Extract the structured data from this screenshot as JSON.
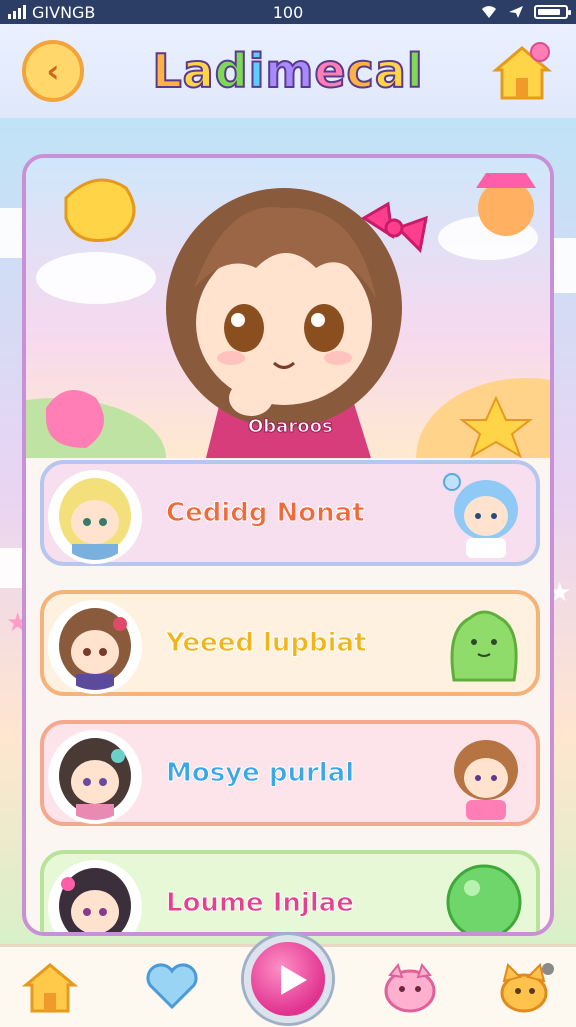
{
  "status_bar": {
    "carrier": "GIVNGB",
    "time": "100",
    "battery_level": 0.85
  },
  "header": {
    "title": "Ladimecal",
    "back_icon": "chevron-left-icon",
    "home_icon": "house-icon"
  },
  "hero": {
    "shirt_text": "Obaroos"
  },
  "menu": {
    "items": [
      {
        "label": "Cedidg Nonat",
        "color": "#f06a3a",
        "bg": "#f7dff0",
        "border": "#b7c6ec"
      },
      {
        "label": "Yeeed lupbiat",
        "color": "#f1b51c",
        "bg": "#fff1df",
        "border": "#f4b479"
      },
      {
        "label": "Mosye purlal",
        "color": "#3aa7e8",
        "bg": "#fde3ea",
        "border": "#f3a98d"
      },
      {
        "label": "Loume Injlae",
        "color": "#e6418f",
        "bg": "#e7f8d6",
        "border": "#b7e39a"
      }
    ]
  },
  "bottom_nav": {
    "items": [
      "home-icon",
      "heart-icon",
      "play-icon",
      "pig-icon",
      "cat-icon"
    ]
  },
  "colors": {
    "accent": "#c98fd7",
    "play": "#e0338f"
  }
}
